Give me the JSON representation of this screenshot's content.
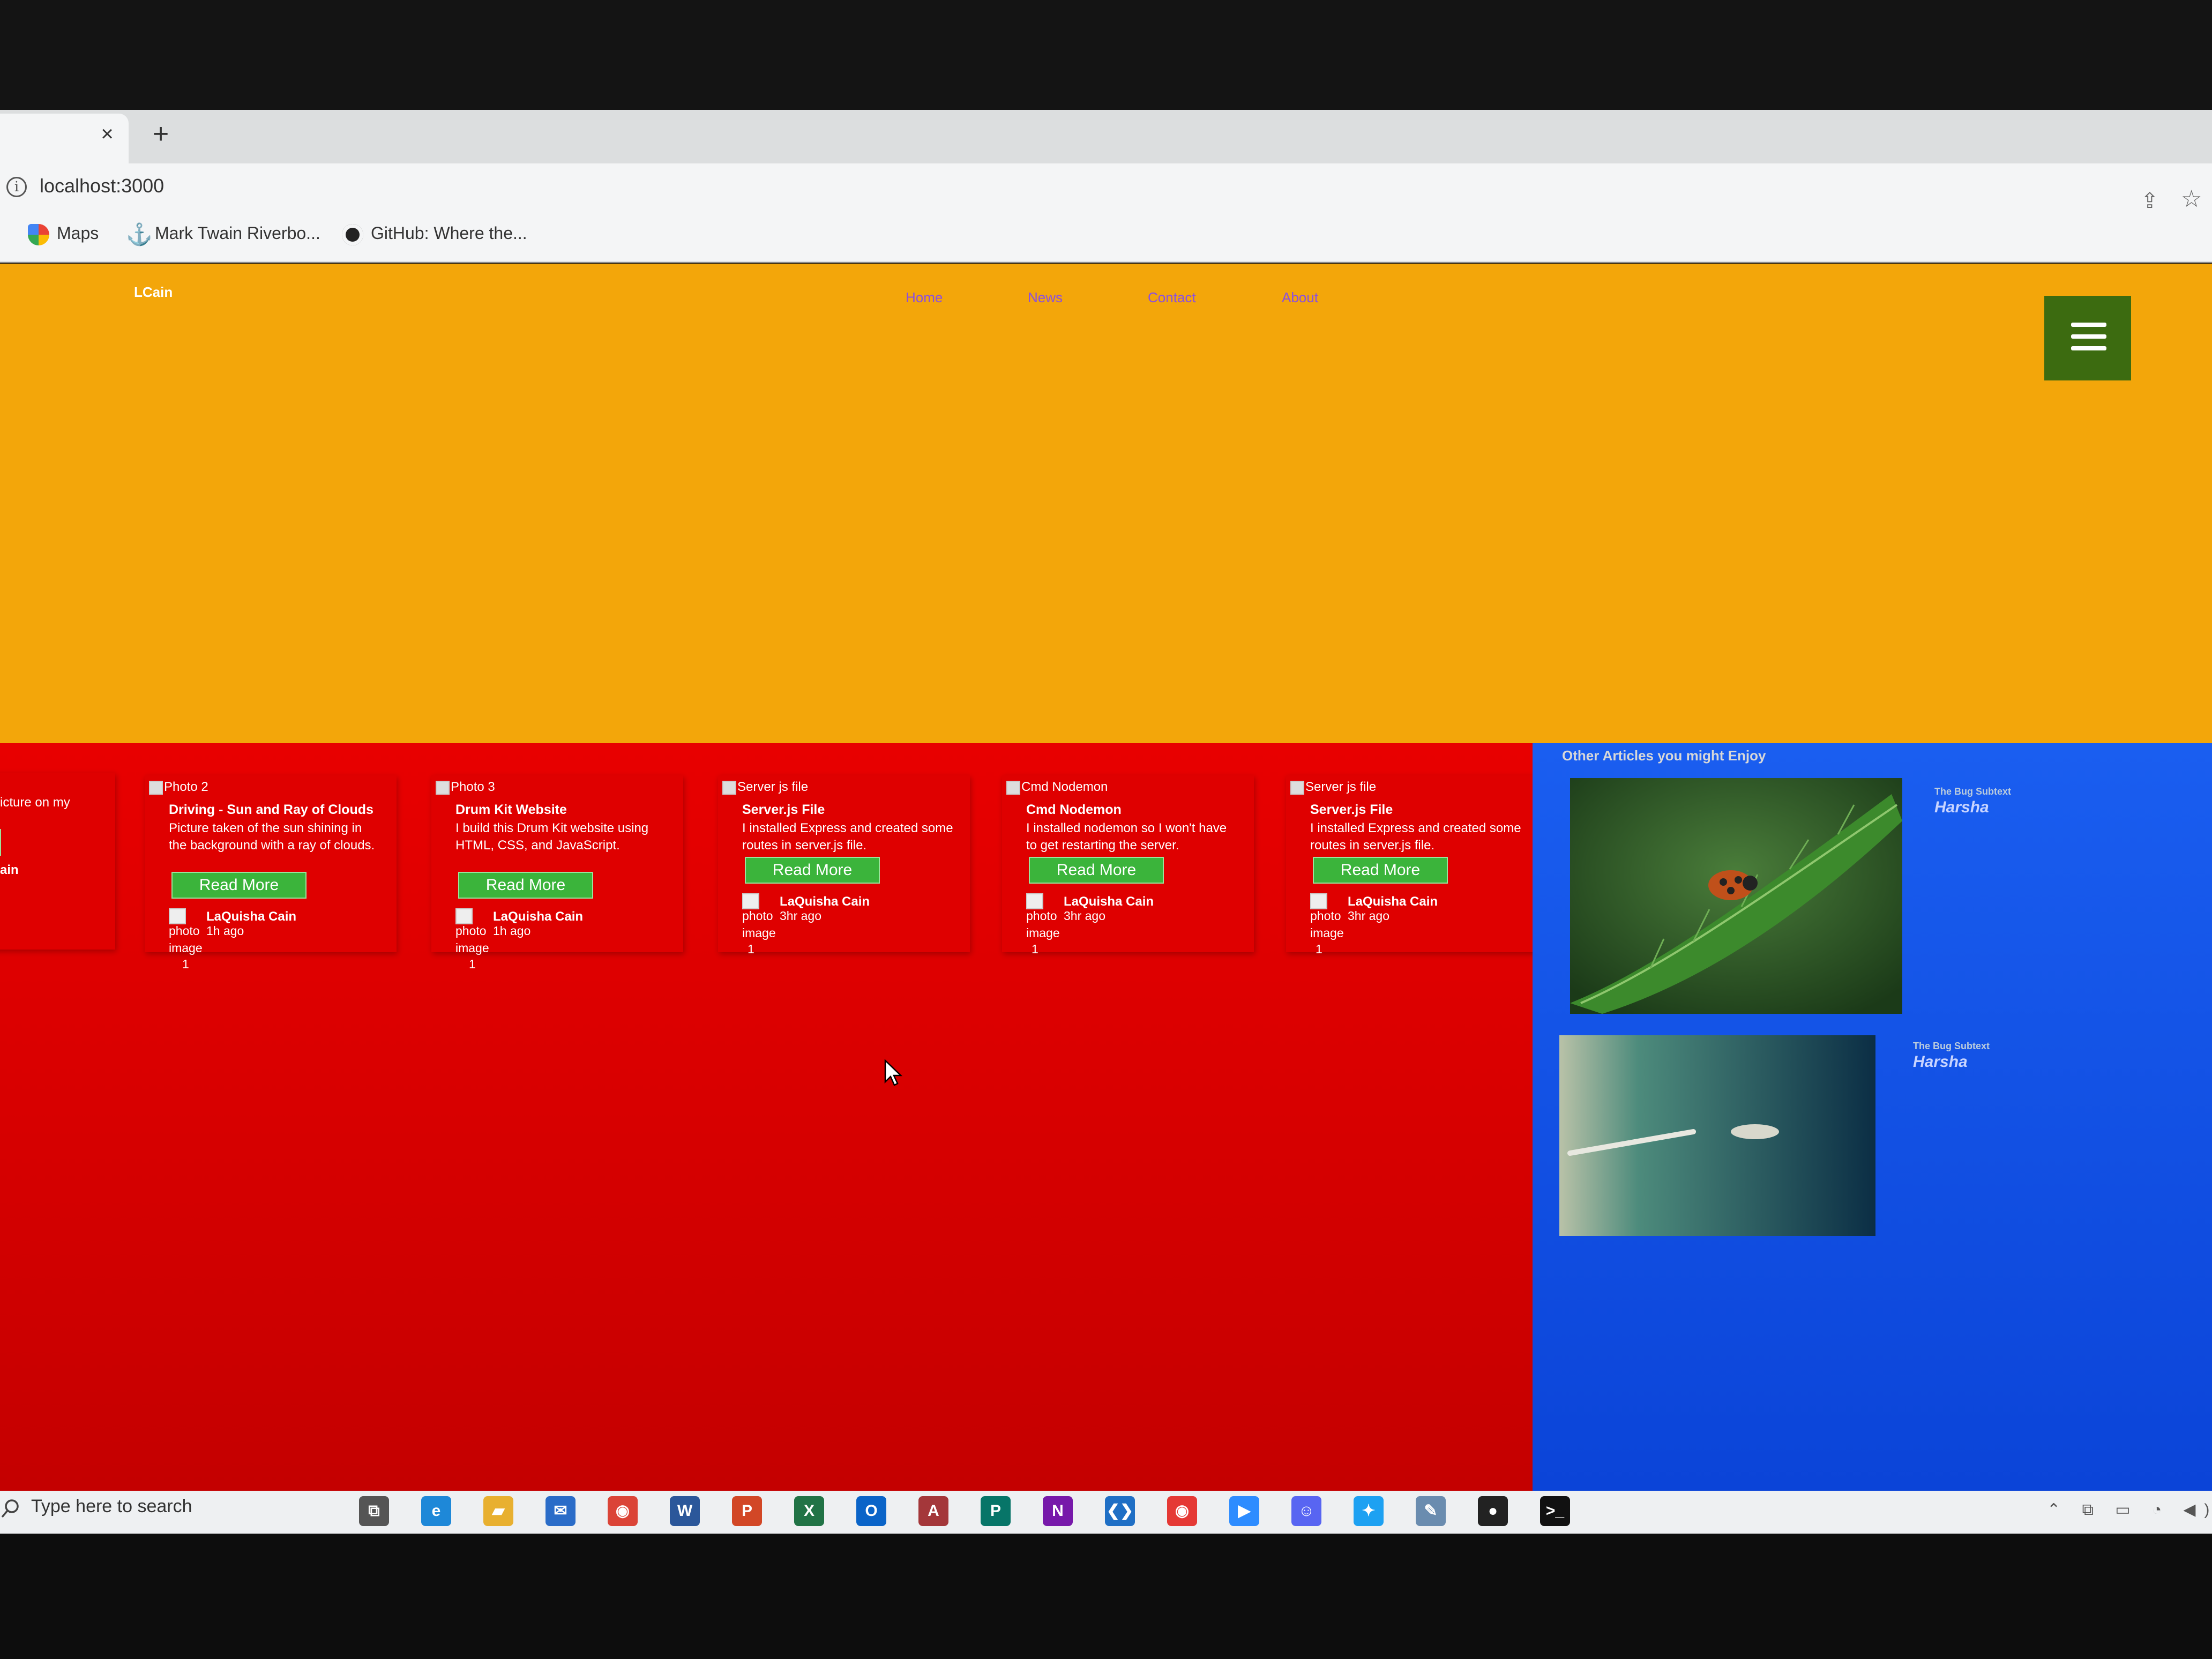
{
  "browser": {
    "tab_close": "×",
    "new_tab": "+",
    "url": "localhost:3000",
    "bookmarks": [
      "Maps",
      "Mark Twain Riverbo...",
      "GitHub: Where the..."
    ]
  },
  "site": {
    "brand": "LCain",
    "nav": [
      "Home",
      "News",
      "Contact",
      "About"
    ],
    "colors": {
      "hero": "#f3a60a",
      "articles": "#e00000",
      "sidebar": "#1455e8",
      "menu": "#3c6b10",
      "button": "#3bb43b"
    }
  },
  "articles": [
    {
      "alt": "",
      "title": "",
      "desc": "icture on my",
      "button": "e",
      "author": "ain",
      "meta_photo": "",
      "time": "",
      "count": ""
    },
    {
      "alt": "Photo 2",
      "title": "Driving - Sun and Ray of Clouds",
      "desc": "Picture taken of the sun shining in the background with a ray of clouds.",
      "button": "Read More",
      "author": "LaQuisha Cain",
      "meta_photo": "photo",
      "time": "1h ago",
      "meta_image": "image",
      "count": "1"
    },
    {
      "alt": "Photo 3",
      "title": "Drum Kit Website",
      "desc": "I build this Drum Kit website using HTML, CSS, and JavaScript.",
      "button": "Read More",
      "author": "LaQuisha Cain",
      "meta_photo": "photo",
      "time": "1h ago",
      "meta_image": "image",
      "count": "1"
    },
    {
      "alt": "Server js file",
      "title": "Server.js File",
      "desc": "I installed Express and created some routes in server.js file.",
      "button": "Read More",
      "author": "LaQuisha Cain",
      "meta_photo": "photo",
      "time": "3hr ago",
      "meta_image": "image",
      "count": "1"
    },
    {
      "alt": "Cmd Nodemon",
      "title": "Cmd Nodemon",
      "desc": "I installed nodemon so I won't have to get restarting the server.",
      "button": "Read More",
      "author": "LaQuisha Cain",
      "meta_photo": "photo",
      "time": "3hr ago",
      "meta_image": "image",
      "count": "1"
    },
    {
      "alt": "Server js file",
      "title": "Server.js File",
      "desc": "I installed Express and created some routes in server.js file.",
      "button": "Read More",
      "author": "LaQuisha Cain",
      "meta_photo": "photo",
      "time": "3hr ago",
      "meta_image": "image",
      "count": "1"
    }
  ],
  "sidebar": {
    "heading": "Other Articles you might Enjoy",
    "items": [
      {
        "subtitle": "The Bug Subtext",
        "name": "Harsha",
        "image": "ladybug-on-leaf"
      },
      {
        "subtitle": "The Bug Subtext",
        "name": "Harsha",
        "image": "bugs-on-water"
      }
    ]
  },
  "taskbar": {
    "search_placeholder": "Type here to search",
    "apps": [
      {
        "name": "task-view",
        "glyph": "⧉",
        "color": "#555"
      },
      {
        "name": "edge",
        "glyph": "e",
        "color": "#1e88d8"
      },
      {
        "name": "file-explorer",
        "glyph": "▰",
        "color": "#e8b030"
      },
      {
        "name": "mail",
        "glyph": "✉",
        "color": "#2a6cc8"
      },
      {
        "name": "chrome",
        "glyph": "◉",
        "color": "#db4437"
      },
      {
        "name": "word",
        "glyph": "W",
        "color": "#2b579a"
      },
      {
        "name": "powerpoint",
        "glyph": "P",
        "color": "#d24726"
      },
      {
        "name": "excel",
        "glyph": "X",
        "color": "#217346"
      },
      {
        "name": "outlook",
        "glyph": "O",
        "color": "#0a64c8"
      },
      {
        "name": "access",
        "glyph": "A",
        "color": "#a4373a"
      },
      {
        "name": "publisher",
        "glyph": "P",
        "color": "#077568"
      },
      {
        "name": "onenote",
        "glyph": "N",
        "color": "#7719aa"
      },
      {
        "name": "vscode",
        "glyph": "❮❯",
        "color": "#1f6fc5"
      },
      {
        "name": "chrome-2",
        "glyph": "◉",
        "color": "#e53935"
      },
      {
        "name": "zoom",
        "glyph": "▶",
        "color": "#2d8cff"
      },
      {
        "name": "discord",
        "glyph": "☺",
        "color": "#5865f2"
      },
      {
        "name": "twitter",
        "glyph": "✦",
        "color": "#1da1f2"
      },
      {
        "name": "pen-app",
        "glyph": "✎",
        "color": "#6a8caf"
      },
      {
        "name": "github",
        "glyph": "●",
        "color": "#222"
      },
      {
        "name": "terminal",
        "glyph": ">_",
        "color": "#111"
      }
    ],
    "tray": "⌃ ⧉ ▭ ◔ ◀)"
  }
}
